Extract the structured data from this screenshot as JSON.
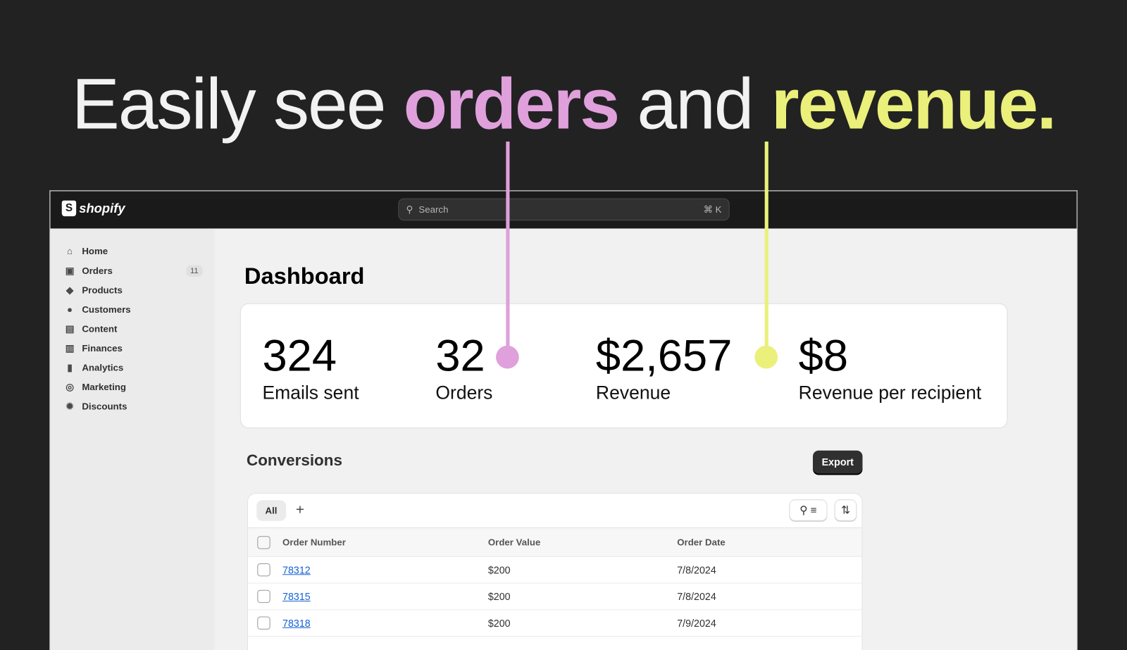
{
  "headline": {
    "part1": "Easily see ",
    "orders": "orders",
    "part2": " and ",
    "revenue": "revenue."
  },
  "colors": {
    "orders": "#dfa0dc",
    "revenue": "#eaf07a",
    "background": "#222222"
  },
  "app": {
    "logo": "shopify",
    "search_placeholder": "Search",
    "search_shortcut": "⌘ K"
  },
  "sidebar": {
    "items": [
      {
        "label": "Home",
        "icon": "home-icon"
      },
      {
        "label": "Orders",
        "icon": "inbox-icon",
        "badge": "11"
      },
      {
        "label": "Products",
        "icon": "tag-icon"
      },
      {
        "label": "Customers",
        "icon": "person-icon"
      },
      {
        "label": "Content",
        "icon": "image-icon"
      },
      {
        "label": "Finances",
        "icon": "bank-icon"
      },
      {
        "label": "Analytics",
        "icon": "bar-chart-icon"
      },
      {
        "label": "Marketing",
        "icon": "target-icon"
      },
      {
        "label": "Discounts",
        "icon": "discount-icon"
      }
    ]
  },
  "dashboard": {
    "title": "Dashboard",
    "stats": [
      {
        "value": "324",
        "label": "Emails sent"
      },
      {
        "value": "32",
        "label": "Orders"
      },
      {
        "value": "$2,657",
        "label": "Revenue"
      },
      {
        "value": "$8",
        "label": "Revenue per recipient"
      }
    ]
  },
  "conversions": {
    "title": "Conversions",
    "export_label": "Export",
    "tab_all": "All",
    "add_tab": "+",
    "columns": [
      "Order Number",
      "Order Value",
      "Order Date"
    ],
    "rows": [
      {
        "number": "78312",
        "value": "$200",
        "date": "7/8/2024"
      },
      {
        "number": "78315",
        "value": "$200",
        "date": "7/8/2024"
      },
      {
        "number": "78318",
        "value": "$200",
        "date": "7/9/2024"
      }
    ]
  }
}
